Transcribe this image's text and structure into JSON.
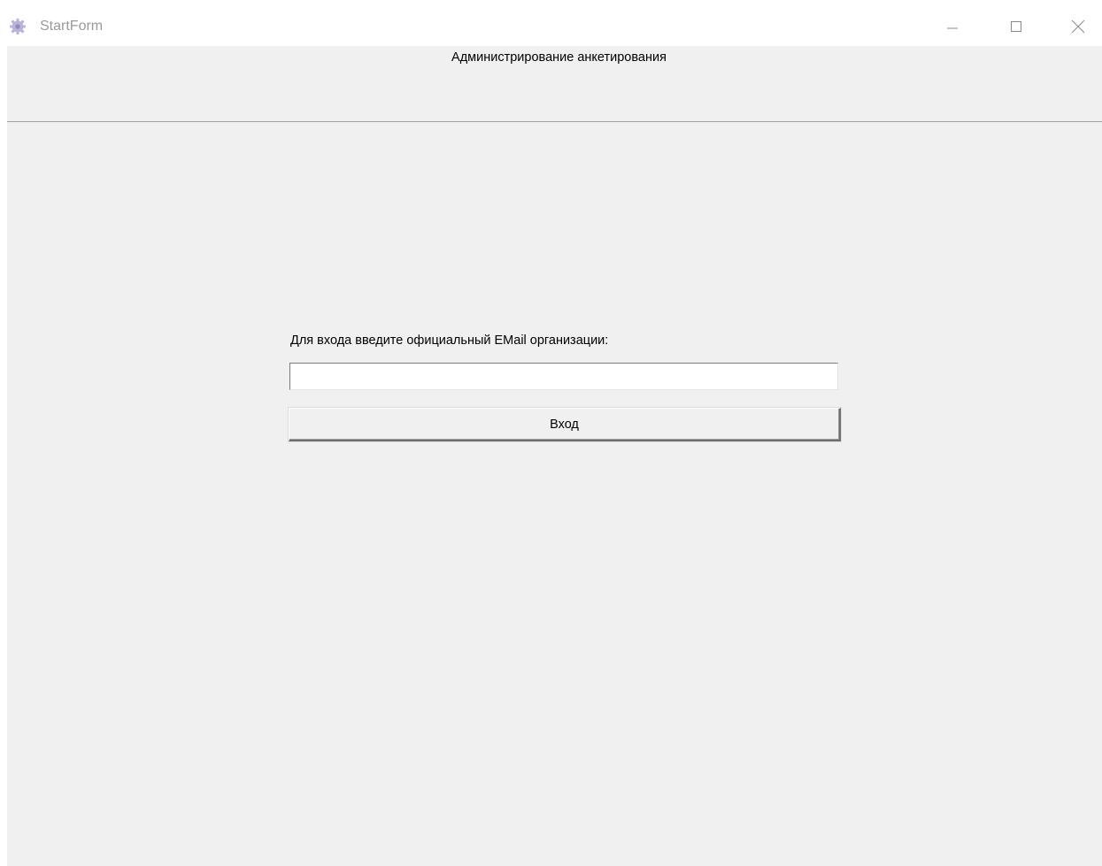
{
  "window": {
    "title": "StartForm",
    "icon": "gear-icon",
    "controls": {
      "minimize": "minimize-icon",
      "maximize": "maximize-icon",
      "close": "close-icon"
    }
  },
  "header": {
    "title": "Администрирование анкетирования"
  },
  "login": {
    "prompt": "Для входа введите официальный EMail организации:",
    "email_value": "",
    "email_placeholder": "",
    "button_label": "Вход"
  },
  "colors": {
    "client_bg": "#f0f0f0",
    "title_text": "#9a9a9a",
    "icon_accent": "#b9b4d8"
  }
}
